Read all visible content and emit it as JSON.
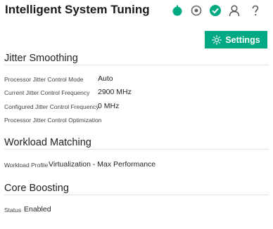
{
  "header": {
    "title": "Intelligent System Tuning",
    "icons": [
      "power-status-icon",
      "locator-icon",
      "health-ok-icon",
      "user-icon",
      "help-icon"
    ],
    "colors": {
      "power": "#01a982",
      "health": "#01a982",
      "icon_gray": "#666666"
    }
  },
  "toolbar": {
    "settings_label": "Settings",
    "accent": "#01a982"
  },
  "jitter_smoothing": {
    "title": "Jitter Smoothing",
    "rows": [
      {
        "label": "Processor Jitter Control Mode",
        "value": "Auto"
      },
      {
        "label": "Current Jitter Control Frequency",
        "value": "2900 MHz"
      },
      {
        "label": "Configured Jitter Control Frequency",
        "value": "0 MHz"
      },
      {
        "label": "Processor Jitter Control Optimization",
        "value": ""
      }
    ]
  },
  "workload_matching": {
    "title": "Workload Matching",
    "profile_label": "Workload Profile",
    "profile_value": "Virtualization - Max Performance"
  },
  "core_boosting": {
    "title": "Core Boosting",
    "status_label": "Status",
    "status_value": "Enabled"
  }
}
